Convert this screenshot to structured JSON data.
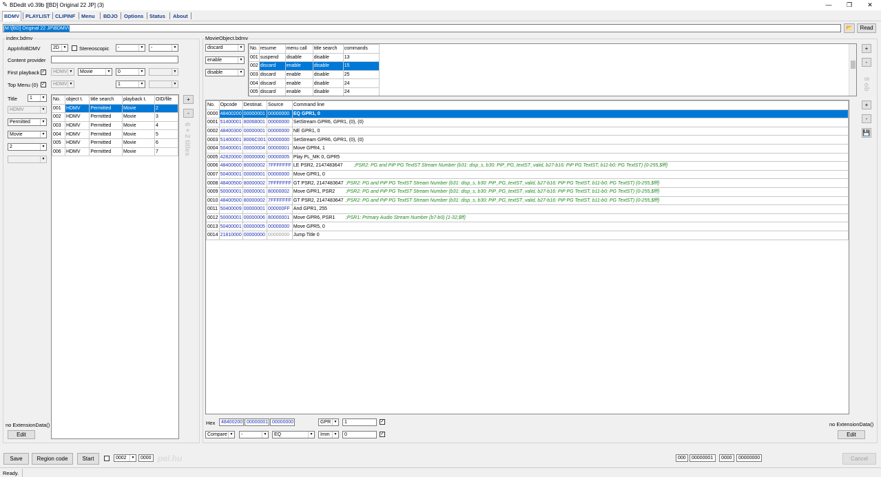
{
  "window": {
    "title": "BDedit v0.39b [[BD] Original 22 JP] (3)",
    "minimize": "—",
    "maximize": "❐",
    "close": "✕"
  },
  "menu": [
    "BDMV",
    "PLAYLIST",
    "CLIPINF",
    "Menu",
    "BDJO",
    "Options",
    "Status",
    "About"
  ],
  "path": {
    "value": "M:\\[BD] Original 22 JP\\BDMV\\",
    "read_label": "Read",
    "folder_icon": "folder-icon"
  },
  "index": {
    "title": "index.bdmv",
    "appinfo_label": "AppInfoBDMV",
    "appinfo_value": "2D",
    "stereoscopic_label": "Stereoscopic",
    "combo_a": "-",
    "combo_b": "-",
    "content_provider_label": "Content provider",
    "content_provider_value": "",
    "first_playback_label": "First playback",
    "first_playback_type": "HDMV",
    "first_playback_mode": "Movie",
    "first_playback_num": "0",
    "top_menu_label": "Top Menu (0)",
    "top_menu_type": "HDMV",
    "top_menu_num": "1",
    "title_label": "Title",
    "title_num": "1",
    "title_type": "HDMV",
    "title_search": "Permitted",
    "title_mode": "Movie",
    "title_obj": "2",
    "titles_columns": [
      "No.",
      "object t.",
      "title search",
      "playback t.",
      "OID/file"
    ],
    "titles_rows": [
      [
        "001",
        "HDMV",
        "Permitted",
        "Movie",
        "2"
      ],
      [
        "002",
        "HDMV",
        "Permitted",
        "Movie",
        "3"
      ],
      [
        "003",
        "HDMV",
        "Permitted",
        "Movie",
        "4"
      ],
      [
        "004",
        "HDMV",
        "Permitted",
        "Movie",
        "5"
      ],
      [
        "005",
        "HDMV",
        "Permitted",
        "Movie",
        "6"
      ],
      [
        "006",
        "HDMV",
        "Permitted",
        "Movie",
        "7"
      ]
    ],
    "add_label": "+",
    "remove_label": "-",
    "vertical_text": "6 + 2 titles",
    "ext_label": "no ExtensionData()",
    "edit_label": "Edit"
  },
  "movie": {
    "title": "MovieObject.bdmv",
    "combo_resume": "discard",
    "combo_menu": "enable",
    "combo_search": "disable",
    "obj_columns": [
      "No.",
      "resume",
      "menu call",
      "title search",
      "commands"
    ],
    "obj_rows": [
      [
        "001",
        "suspend",
        "disable",
        "disable",
        "13"
      ],
      [
        "002",
        "discard",
        "enable",
        "disable",
        "15"
      ],
      [
        "003",
        "discard",
        "enable",
        "disable",
        "25"
      ],
      [
        "004",
        "discard",
        "enable",
        "disable",
        "24"
      ],
      [
        "005",
        "discard",
        "enable",
        "disable",
        "24"
      ]
    ],
    "vertical_text": "8 ob",
    "cmd_columns": [
      "No.",
      "Opcode",
      "Destinat.",
      "Source",
      "Command line"
    ],
    "cmd_rows": [
      [
        "0000",
        "48400200",
        "00000001",
        "00000000",
        "EQ GPR1, 0",
        ""
      ],
      [
        "0001",
        "51400001",
        "80068001",
        "00000000",
        "SetStream GPR6, GPR1, (0), (0)",
        ""
      ],
      [
        "0002",
        "48400300",
        "00000001",
        "00000000",
        "NE GPR1, 0",
        ""
      ],
      [
        "0003",
        "51400001",
        "8006C001",
        "00000000",
        "SetStream GPR6, GPR1, (0), (0)",
        ""
      ],
      [
        "0004",
        "50400001",
        "00000004",
        "00000001",
        "Move GPR4, 1",
        ""
      ],
      [
        "0005",
        "42820000",
        "00000000",
        "00000005",
        "Play PL_MK 0, GPR5",
        ""
      ],
      [
        "0006",
        "48400600",
        "80000002",
        "7FFFFFFF",
        "LE PSR2, 2147483647",
        ";PSR2: PG and PiP PG TextST Stream Number (b31: disp_s, b30: PiP_PG_textST_valid, b27-b16: PiP PG TextST, b11-b0: PG TextST) {0-255,$fff}"
      ],
      [
        "0007",
        "50400001",
        "00000001",
        "00000000",
        "Move GPR1, 0",
        ""
      ],
      [
        "0008",
        "48400500",
        "80000002",
        "7FFFFFFF",
        "GT PSR2, 2147483647",
        ";PSR2: PG and PiP PG TextST Stream Number (b31: disp_s, b30: PiP_PG_textST_valid, b27-b16: PiP PG TextST, b11-b0: PG TextST) {0-255,$fff}"
      ],
      [
        "0009",
        "50000001",
        "00000001",
        "80000002",
        "Move GPR1, PSR2",
        ";PSR2: PG and PiP PG TextST Stream Number (b31: disp_s, b30: PiP_PG_textST_valid, b27-b16: PiP PG TextST, b11-b0: PG TextST) {0-255,$fff}"
      ],
      [
        "0010",
        "48400500",
        "80000002",
        "7FFFFFFF",
        "GT PSR2, 2147483647",
        ";PSR2: PG and PiP PG TextST Stream Number (b31: disp_s, b30: PiP_PG_textST_valid, b27-b16: PiP PG TextST, b11-b0: PG TextST) {0-255,$fff}"
      ],
      [
        "0011",
        "50400009",
        "00000001",
        "000000FF",
        "And GPR1, 255",
        ""
      ],
      [
        "0012",
        "50000001",
        "00000006",
        "80000001",
        "Move GPR6, PSR1",
        ";PSR1: Primary Audio Stream Number (b7-b0) {1-32,$ff}"
      ],
      [
        "0013",
        "50400001",
        "00000005",
        "00000000",
        "Move GPR5, 0",
        ""
      ],
      [
        "0014",
        "21810000",
        "00000000",
        "00000000",
        "Jump Title 0",
        ""
      ]
    ],
    "hex_label": "Hex",
    "hex_op": "48400200",
    "hex_dst": "00000001",
    "hex_src": "00000000",
    "operand1_type": "GPR",
    "operand1_value": "1",
    "compare_label": "Compare",
    "dash_value": "-",
    "eq_value": "EQ",
    "operand2_type": "Imm",
    "operand2_value": "0",
    "ext_label": "no ExtensionData()",
    "edit_label": "Edit",
    "side_plus": "+",
    "side_minus": "-"
  },
  "bottom": {
    "save_label": "Save",
    "region_label": "Region code",
    "start_label": "Start",
    "start_combo": "0002",
    "start_value": "0000",
    "watermark": "pel.hu",
    "f1": "000",
    "f2": "00000001",
    "f3": "0000",
    "f4": "00000000",
    "cancel_label": "Cancel"
  },
  "status": {
    "text": "Ready."
  },
  "colors": {
    "selection": "#0078d7",
    "hex_blue": "#1b2fb5",
    "comment_green": "#1a8a1a"
  }
}
